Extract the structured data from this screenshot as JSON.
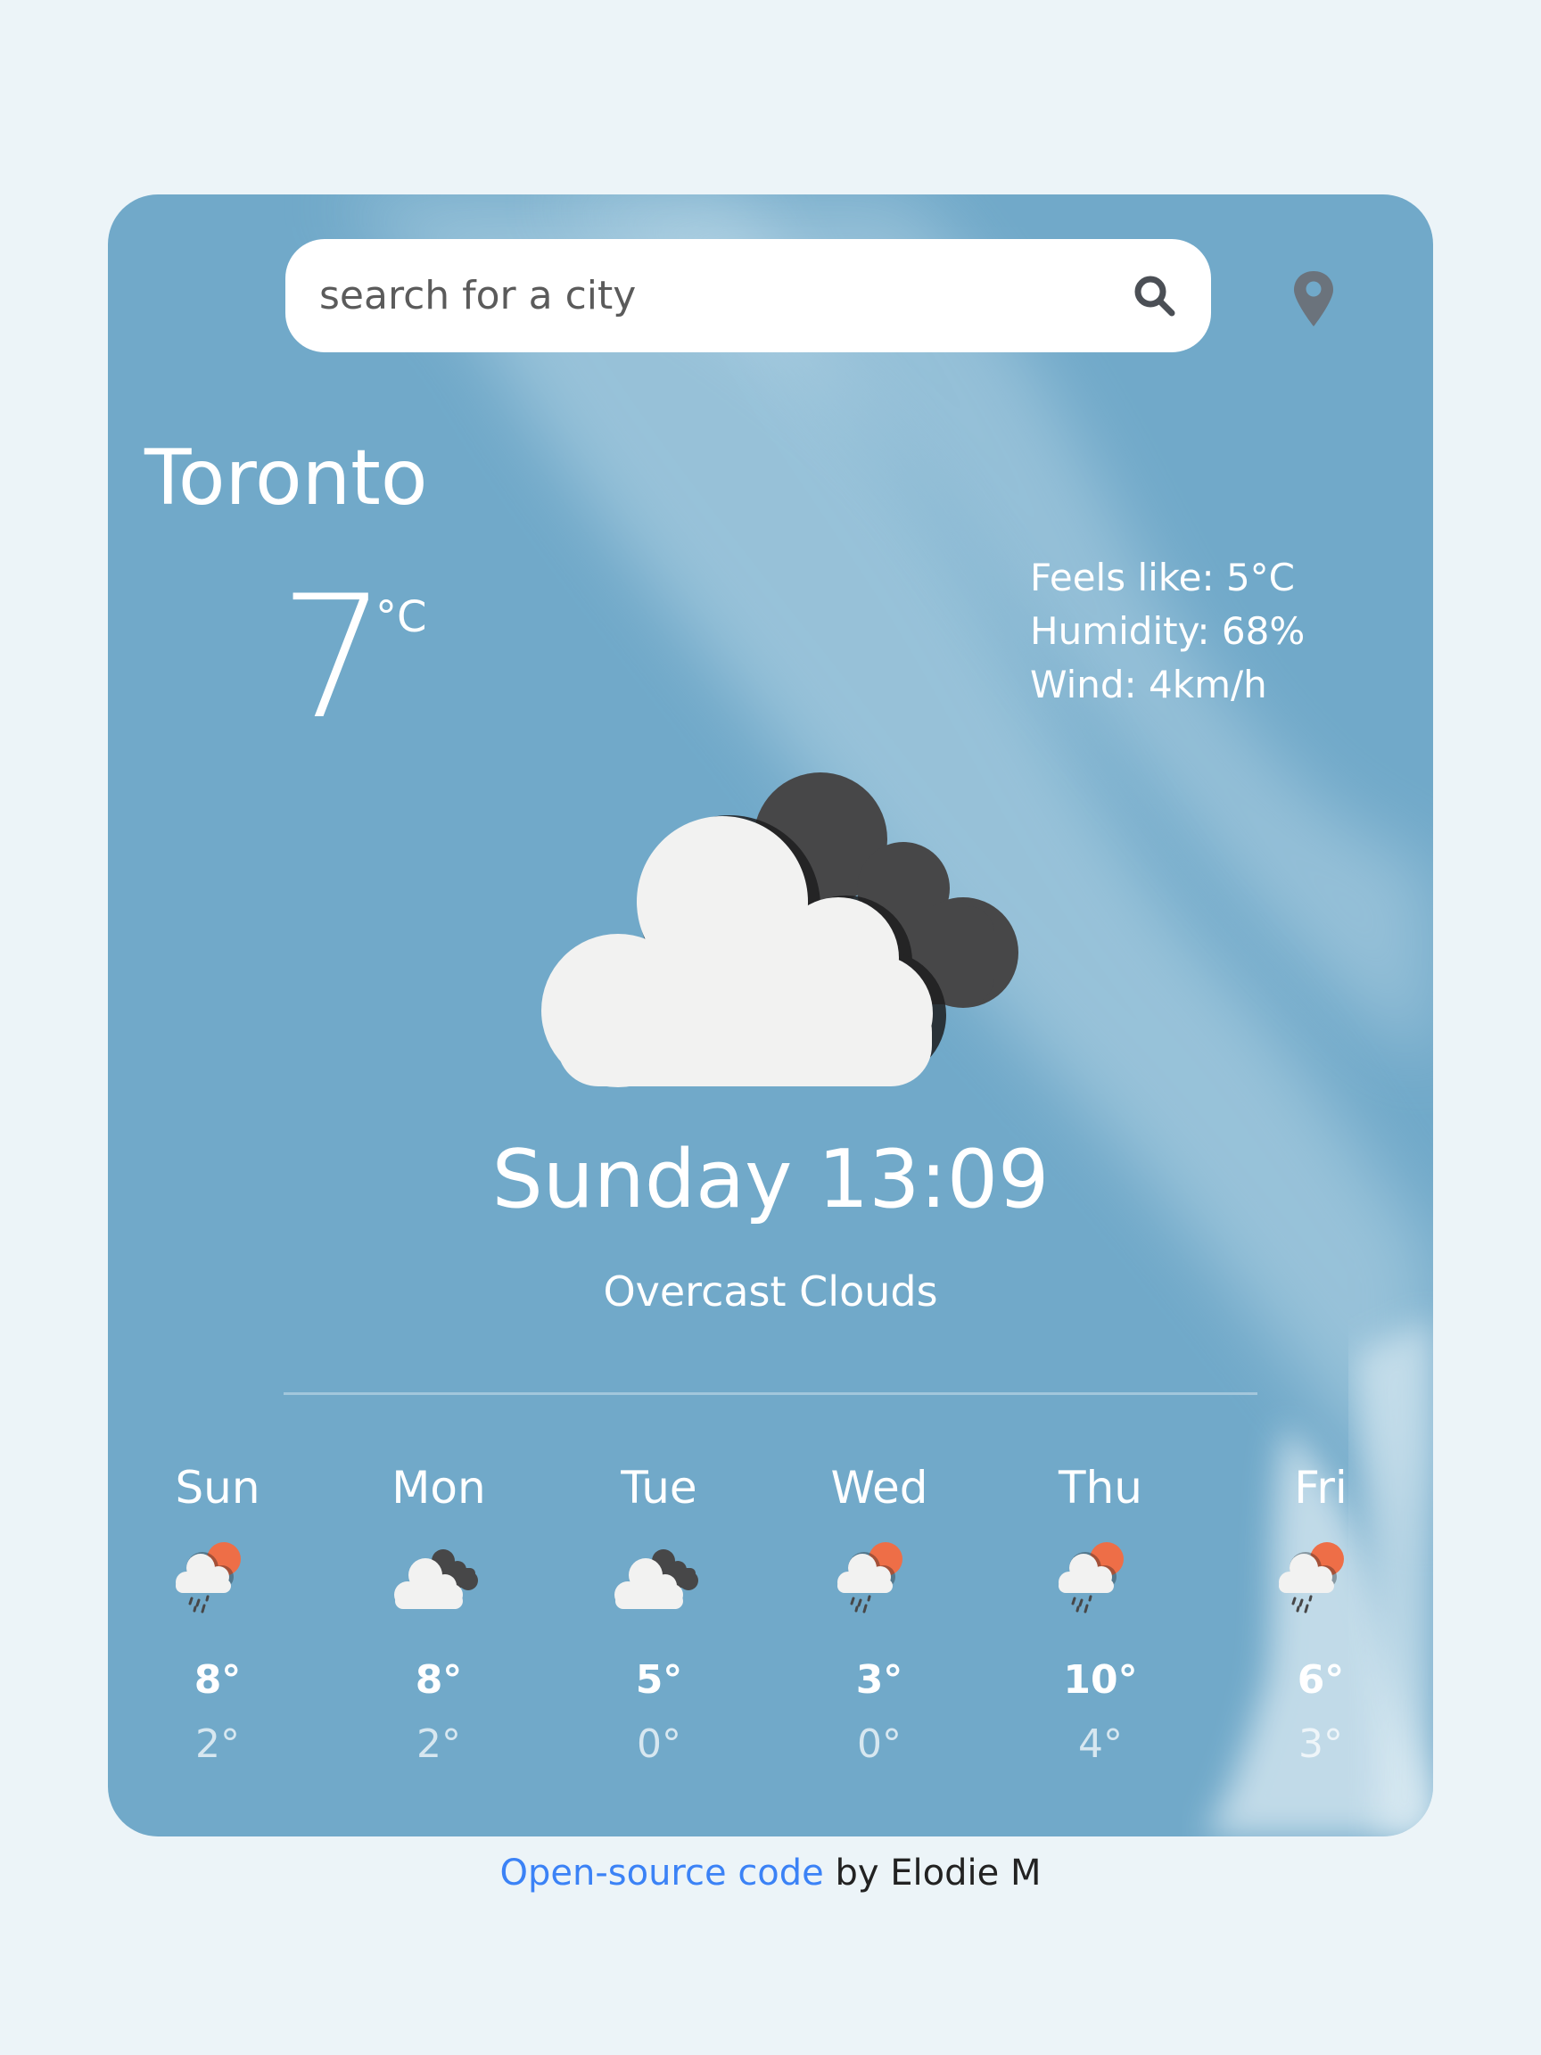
{
  "search": {
    "placeholder": "search for a city",
    "value": "",
    "search_icon": "search-icon",
    "location_icon": "map-pin-icon"
  },
  "current": {
    "city": "Toronto",
    "temperature": "7",
    "unit": "°C",
    "feels_like": "Feels like: 5°C",
    "humidity": "Humidity: 68%",
    "wind": "Wind: 4km/h",
    "icon": "overcast-clouds-icon",
    "datetime": "Sunday 13:09",
    "description": "Overcast Clouds"
  },
  "forecast": [
    {
      "day": "Sun",
      "icon": "rain-sun-icon",
      "max": "8°",
      "min": "2°"
    },
    {
      "day": "Mon",
      "icon": "overcast-clouds-icon",
      "max": "8°",
      "min": "2°"
    },
    {
      "day": "Tue",
      "icon": "overcast-clouds-icon",
      "max": "5°",
      "min": "0°"
    },
    {
      "day": "Wed",
      "icon": "rain-sun-icon",
      "max": "3°",
      "min": "0°"
    },
    {
      "day": "Thu",
      "icon": "rain-sun-icon",
      "max": "10°",
      "min": "4°"
    },
    {
      "day": "Fri",
      "icon": "rain-sun-icon",
      "max": "6°",
      "min": "3°"
    }
  ],
  "footer": {
    "link_text": "Open-source code",
    "suffix": " by Elodie M"
  },
  "colors": {
    "page_background": "#ecf4f8",
    "card_background": "#71a9c9",
    "sun": "#ee6e47",
    "dark_cloud": "#474748",
    "light_cloud": "#f2f2f1",
    "link": "#3b82f6",
    "icon_gray": "#6b737c"
  }
}
